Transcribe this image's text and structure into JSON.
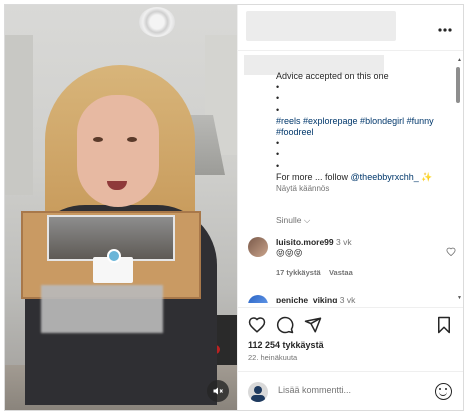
{
  "post": {
    "more_icon": "more-horizontal-icon",
    "caption": {
      "line1": "Advice accepted on this one",
      "bullets": [
        "•",
        "•",
        "•"
      ],
      "hashtags": "#reels #explorepage #blondegirl #funny #foodreel",
      "bullets2": [
        "•",
        "•",
        "•"
      ],
      "follow_text": "For more ... follow",
      "follow_handle": "@theebbyrxchh_",
      "sparkle": "✨",
      "translation": "Näytä käännös"
    },
    "for_you": "Sinulle",
    "comments": [
      {
        "user": "luisito.more99",
        "time": "3 vk",
        "text": "😝😝😝",
        "likes": "17 tykkäystä",
        "reply": "Vastaa"
      },
      {
        "user": "peniche_viking",
        "time": "3 vk",
        "text": "",
        "likes": "",
        "reply": ""
      }
    ],
    "likes_count": "112 254 tykkäystä",
    "date": "22. heinäkuuta",
    "add_comment_placeholder": "Lisää kommentti..."
  },
  "icons": {
    "heart": "heart-icon",
    "comment": "comment-icon",
    "share": "share-icon",
    "save": "bookmark-icon",
    "mute": "volume-mute-icon",
    "emoji": "emoji-icon"
  }
}
